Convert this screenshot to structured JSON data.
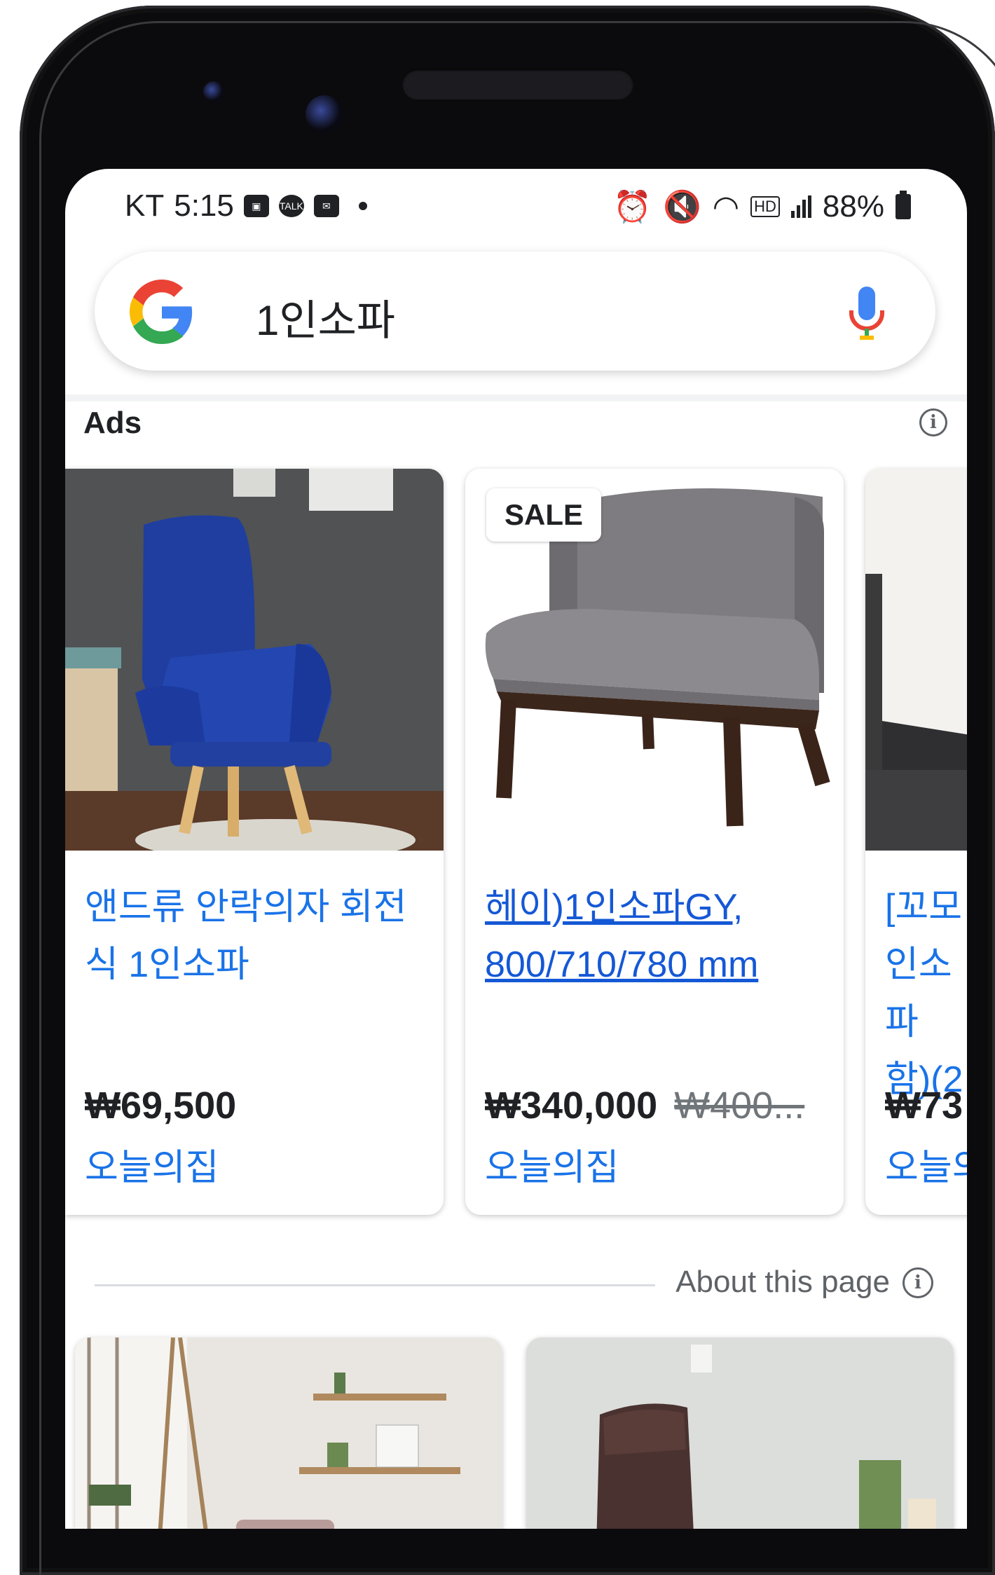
{
  "status_bar": {
    "carrier": "KT",
    "time": "5:15",
    "network": "HD",
    "battery": "88%"
  },
  "search": {
    "query": "1인소파"
  },
  "ads": {
    "label": "Ads",
    "products": [
      {
        "title": "앤드류 안락의자 회전식 1인소파",
        "price": "₩69,500",
        "old_price": "",
        "merchant": "오늘의집",
        "badge": ""
      },
      {
        "title": "헤이)1인소파GY, 800/710/780 mm",
        "price": "₩340,000",
        "old_price": "₩400...",
        "merchant": "오늘의집",
        "badge": "SALE"
      },
      {
        "title": "[꼬모 인소파 함)(2",
        "price": "₩73",
        "old_price": "",
        "merchant": "오늘의집",
        "badge": ""
      }
    ]
  },
  "about": {
    "label": "About this page"
  },
  "colors": {
    "link_blue": "#1a73e8",
    "text": "#202124",
    "grey": "#5f6368"
  }
}
